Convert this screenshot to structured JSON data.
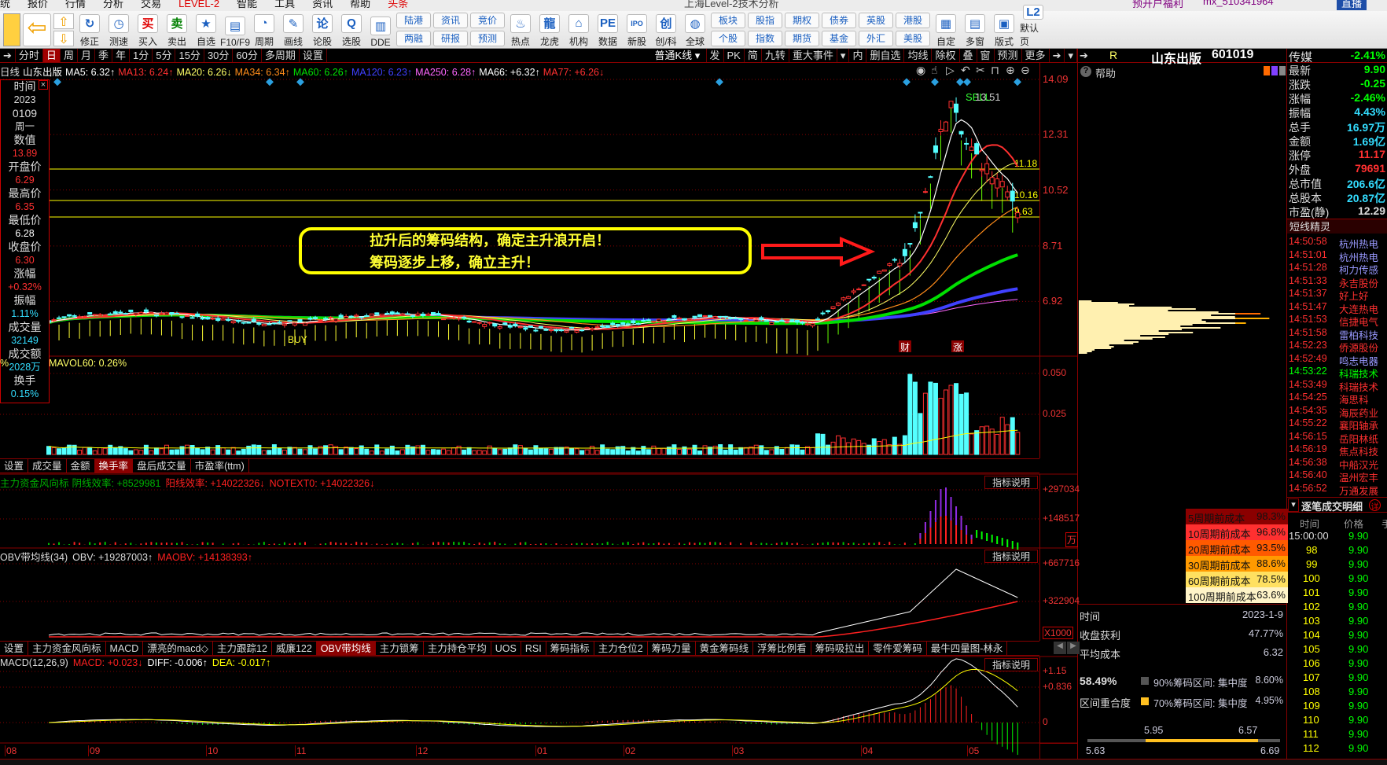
{
  "menubar": {
    "items": [
      "统",
      "报价",
      "行情",
      "分析",
      "交易",
      "LEVEL-2",
      "智能",
      "工具",
      "资讯",
      "帮助",
      "头条"
    ],
    "title": "上海Level-2技术分析",
    "promo": "预开户福利",
    "account": "mx_510341964",
    "live": "直播"
  },
  "toolbar": {
    "buttons": [
      {
        "label": "修正",
        "icon": "refresh-icon",
        "glyph": "↻"
      },
      {
        "label": "测速",
        "icon": "clock-icon",
        "glyph": "◷"
      },
      {
        "label": "买入",
        "icon": "buy-icon",
        "glyph": "买",
        "color": "#e00000"
      },
      {
        "label": "卖出",
        "icon": "sell-icon",
        "glyph": "卖",
        "color": "#008000"
      },
      {
        "label": "自选",
        "icon": "folder-star-icon",
        "glyph": "★"
      },
      {
        "label": "F10/F9",
        "icon": "document-icon",
        "glyph": "▤"
      },
      {
        "label": "周期",
        "icon": "period-clock-icon",
        "glyph": "◔"
      },
      {
        "label": "画线",
        "icon": "pencil-icon",
        "glyph": "✎"
      },
      {
        "label": "论股",
        "icon": "discuss-icon",
        "glyph": "论"
      },
      {
        "label": "选股",
        "icon": "magnifier-icon",
        "glyph": "Q"
      },
      {
        "label": "DDE",
        "icon": "dde-chart-icon",
        "glyph": "▥"
      }
    ],
    "pairs1": [
      [
        "陆港",
        "两融"
      ],
      [
        "资讯",
        "研报"
      ],
      [
        "竞价",
        "预测"
      ]
    ],
    "buttons2": [
      {
        "label": "热点",
        "icon": "hot-fire-icon",
        "glyph": "♨"
      },
      {
        "label": "龙虎",
        "icon": "dragon-icon",
        "glyph": "龍"
      },
      {
        "label": "机构",
        "icon": "institution-icon",
        "glyph": "⌂"
      },
      {
        "label": "数据",
        "icon": "pe-data-icon",
        "glyph": "PE"
      },
      {
        "label": "新股",
        "icon": "ipo-icon",
        "glyph": "IPO"
      },
      {
        "label": "创/科",
        "icon": "chuang-icon",
        "glyph": "创"
      },
      {
        "label": "全球",
        "icon": "globe-icon",
        "glyph": "◍"
      }
    ],
    "pairs2": [
      [
        "板块",
        "个股"
      ],
      [
        "股指",
        "指数"
      ],
      [
        "期权",
        "期货"
      ],
      [
        "债券",
        "基金"
      ],
      [
        "英股",
        "外汇"
      ],
      [
        "港股",
        "美股"
      ]
    ],
    "buttons3": [
      {
        "label": "自定",
        "icon": "custom-icon",
        "glyph": "▦"
      },
      {
        "label": "多窗",
        "icon": "multi-window-icon",
        "glyph": "▤"
      },
      {
        "label": "版式",
        "icon": "layout-icon",
        "glyph": "▣"
      },
      {
        "label": "默认页",
        "icon": "home-l2-icon",
        "glyph": "L2"
      }
    ]
  },
  "periods": {
    "items": [
      "分时",
      "日",
      "周",
      "月",
      "季",
      "年",
      "1分",
      "5分",
      "15分",
      "30分",
      "60分",
      "多周期",
      "设置"
    ],
    "selected": "日",
    "right": [
      "普通K线 ▾",
      "发",
      "PK",
      "简",
      "九转",
      "重大事件",
      "▾",
      "内",
      "删自选",
      "均线",
      "除权",
      "叠",
      "窗",
      "预测",
      "更多",
      "➔",
      "▾"
    ]
  },
  "ma_legend": {
    "prefix": "日线",
    "stock": "山东出版",
    "items": [
      {
        "text": "MA5: 6.32↑",
        "color": "#ffffff"
      },
      {
        "text": "MA13: 6.24↑",
        "color": "#ff3030"
      },
      {
        "text": "MA20: 6.26↓",
        "color": "#ffff66"
      },
      {
        "text": "MA34: 6.34↑",
        "color": "#ff8c1a"
      },
      {
        "text": "MA60: 6.26↑",
        "color": "#00e000"
      },
      {
        "text": "MA120: 6.23↑",
        "color": "#4040ff"
      },
      {
        "text": "MA250: 6.28↑",
        "color": "#ff66ff"
      },
      {
        "text": "MA66: +6.32↑",
        "color": "#ffffff"
      },
      {
        "text": "MA77: +6.26↓",
        "color": "#ff3030"
      }
    ]
  },
  "info_panel": [
    {
      "t": "时间",
      "c": "#ddd"
    },
    {
      "t": "2023",
      "c": "#ddd"
    },
    {
      "t": "0109",
      "c": "#ddd"
    },
    {
      "t": "周一",
      "c": "#ddd"
    },
    {
      "t": "数值",
      "c": "#ddd"
    },
    {
      "t": "13.89",
      "c": "#ff3030"
    },
    {
      "t": "开盘价",
      "c": "#ddd"
    },
    {
      "t": "6.29",
      "c": "#ff3030"
    },
    {
      "t": "最高价",
      "c": "#ddd"
    },
    {
      "t": "6.35",
      "c": "#ff3030"
    },
    {
      "t": "最低价",
      "c": "#ddd"
    },
    {
      "t": "6.28",
      "c": "#fff"
    },
    {
      "t": "收盘价",
      "c": "#ddd"
    },
    {
      "t": "6.30",
      "c": "#ff3030"
    },
    {
      "t": "涨幅",
      "c": "#ddd"
    },
    {
      "t": "+0.32%",
      "c": "#ff3030"
    },
    {
      "t": "振幅",
      "c": "#ddd"
    },
    {
      "t": "1.11%",
      "c": "#33ddff"
    },
    {
      "t": "成交量",
      "c": "#ddd"
    },
    {
      "t": "32149",
      "c": "#33ddff"
    },
    {
      "t": "成交额",
      "c": "#ddd"
    },
    {
      "t": "2028万",
      "c": "#33ddff"
    },
    {
      "t": "换手",
      "c": "#ddd"
    },
    {
      "t": "0.15%",
      "c": "#33ddff"
    }
  ],
  "main_chart": {
    "price_ticks": [
      "14.09",
      "12.31",
      "10.52",
      "8.71",
      "6.92"
    ],
    "high_label": "13.51",
    "sell_label": "SELL",
    "buy_label": "BUY",
    "levels": [
      "11.18",
      "10.16",
      "9.63"
    ],
    "event_labels": [
      "财",
      "涨"
    ],
    "annotation": [
      "拉升后的筹码结构，确定主升浪开启！",
      "筹码逐步上移，确立主升！"
    ]
  },
  "volume": {
    "header": "MAVOL60: 0.26%",
    "ticks": [
      "0.050",
      "0.025"
    ]
  },
  "tabs1": {
    "items": [
      "设置",
      "成交量",
      "金额",
      "换手率",
      "盘后成交量",
      "市盈率(ttm)"
    ],
    "selected": "换手率"
  },
  "ind1": {
    "name": "主力资金风向标",
    "items": [
      {
        "text": "阴线效率: +8529981",
        "color": "#00b000"
      },
      {
        "text": "阳线效率: +14022326↓",
        "color": "#ff2020"
      },
      {
        "text": "NOTEXT0: +14022326↓",
        "color": "#ff2020"
      }
    ],
    "ticks": [
      "+297034",
      "+148517"
    ],
    "unit": "万",
    "explain": "指标说明"
  },
  "obv": {
    "items": [
      {
        "text": "OBV带均线(34)",
        "color": "#ddd"
      },
      {
        "text": "OBV: +19287003↑",
        "color": "#ddd"
      },
      {
        "text": "MAOBV: +14138393↑",
        "color": "#ff2020"
      }
    ],
    "ticks": [
      "+667716",
      "+322904"
    ],
    "unit": "X1000",
    "explain": "指标说明"
  },
  "tabs2": {
    "items": [
      "设置",
      "主力资金风向标",
      "MACD",
      "漂亮的macd◇",
      "主力跟踪12",
      "威廉122",
      "OBV带均线",
      "主力锁筹",
      "主力持仓平均",
      "UOS",
      "RSI",
      "筹码指标",
      "主力仓位2",
      "筹码力量",
      "黄金筹码线",
      "浮筹比例看",
      "筹码吸拉出",
      "零件爱筹码",
      "最牛四量图-林永"
    ],
    "selected": "OBV带均线"
  },
  "macd": {
    "items": [
      {
        "text": "MACD(12,26,9)",
        "color": "#ddd"
      },
      {
        "text": "MACD: +0.023↓",
        "color": "#ff2020"
      },
      {
        "text": "DIFF: -0.006↑",
        "color": "#fff"
      },
      {
        "text": "DEA: -0.017↑",
        "color": "#ffff00"
      }
    ],
    "ticks": [
      "+1.15",
      "+0.836",
      "0"
    ],
    "explain": "指标说明"
  },
  "x_axis": [
    "08",
    "09",
    "10",
    "11",
    "12",
    "01",
    "02",
    "03",
    "04",
    "05"
  ],
  "chip_panel": {
    "flag": "R",
    "stock": "山东出版",
    "code": "601019",
    "help": "帮助",
    "cost_table": [
      {
        "label": "5周期前成本",
        "value": "98.3%",
        "bg": "#8b0000"
      },
      {
        "label": "10周期前成本",
        "value": "96.8%",
        "bg": "#ff3030"
      },
      {
        "label": "20周期前成本",
        "value": "93.5%",
        "bg": "#ff5a00"
      },
      {
        "label": "30周期前成本",
        "value": "88.6%",
        "bg": "#ff9a00"
      },
      {
        "label": "60周期前成本",
        "value": "78.5%",
        "bg": "#ffe060"
      },
      {
        "label": "100周期前成本",
        "value": "63.6%",
        "bg": "#fff4c8"
      }
    ],
    "stats": [
      {
        "k": "时间",
        "v": "2023-1-9"
      },
      {
        "k": "收盘获利",
        "v": "47.77%"
      },
      {
        "k": "平均成本",
        "v": "6.32"
      }
    ],
    "overlap_value": "58.49%",
    "overlap_label": "区间重合度",
    "ranges": [
      {
        "text": "90%筹码区间: 集中度",
        "value": "8.60%",
        "color": "#555555"
      },
      {
        "text": "70%筹码区间: 集中度",
        "value": "4.95%",
        "color": "#ffc020"
      }
    ],
    "bar": {
      "inner_low": "5.95",
      "inner_high": "6.57",
      "outer_low": "5.63",
      "outer_high": "6.69"
    }
  },
  "quote": {
    "sector": "传媒",
    "sector_change": "-2.41%",
    "rows": [
      {
        "k": "最新",
        "v": "9.90",
        "c": "#00ff00"
      },
      {
        "k": "涨跌",
        "v": "-0.25",
        "c": "#00ff00"
      },
      {
        "k": "涨幅",
        "v": "-2.46%",
        "c": "#00ff00"
      },
      {
        "k": "振幅",
        "v": "4.43%",
        "c": "#33ddff"
      },
      {
        "k": "总手",
        "v": "16.97万",
        "c": "#33ddff"
      },
      {
        "k": "金额",
        "v": "1.69亿",
        "c": "#33ddff"
      },
      {
        "k": "涨停",
        "v": "11.17",
        "c": "#ff3030"
      },
      {
        "k": "外盘",
        "v": "79691",
        "c": "#ff3030"
      },
      {
        "k": "总市值",
        "v": "206.6亿",
        "c": "#33ddff"
      },
      {
        "k": "总股本",
        "v": "20.87亿",
        "c": "#33ddff"
      },
      {
        "k": "市盈(静)",
        "v": "12.29",
        "c": "#ddd"
      }
    ],
    "sprite_title": "短线精灵",
    "sprite": [
      {
        "t": "14:50:58",
        "n": "杭州热电",
        "c": "#9999ff"
      },
      {
        "t": "14:51:01",
        "n": "杭州热电",
        "c": "#9999ff"
      },
      {
        "t": "14:51:28",
        "n": "柯力传感",
        "c": "#9999ff"
      },
      {
        "t": "14:51:33",
        "n": "永吉股份",
        "c": "#ff3030"
      },
      {
        "t": "14:51:37",
        "n": "好上好",
        "c": "#ff3030"
      },
      {
        "t": "14:51:47",
        "n": "大连热电",
        "c": "#ff3030"
      },
      {
        "t": "14:51:53",
        "n": "信捷电气",
        "c": "#ff3030"
      },
      {
        "t": "14:51:58",
        "n": "雷柏科技",
        "c": "#9999ff"
      },
      {
        "t": "14:52:23",
        "n": "侨源股份",
        "c": "#ff3030"
      },
      {
        "t": "14:52:49",
        "n": "鸣志电器",
        "c": "#9999ff"
      },
      {
        "t": "14:53:22",
        "n": "科瑞技术",
        "c": "#00ff00",
        "tc": "#00ff00"
      },
      {
        "t": "14:53:49",
        "n": "科瑞技术",
        "c": "#ff3030"
      },
      {
        "t": "14:54:25",
        "n": "海思科",
        "c": "#ff3030"
      },
      {
        "t": "14:54:35",
        "n": "海辰药业",
        "c": "#ff3030"
      },
      {
        "t": "14:55:22",
        "n": "襄阳轴承",
        "c": "#ff3030"
      },
      {
        "t": "14:56:15",
        "n": "岳阳林纸",
        "c": "#ff3030"
      },
      {
        "t": "14:56:19",
        "n": "焦点科技",
        "c": "#ff3030"
      },
      {
        "t": "14:56:38",
        "n": "中船汉光",
        "c": "#ff3030"
      },
      {
        "t": "14:56:40",
        "n": "温州宏丰",
        "c": "#ff3030"
      },
      {
        "t": "14:56:52",
        "n": "万通发展",
        "c": "#ff3030"
      }
    ],
    "trades_title": "逐笔成交明细",
    "trades_badge": "详",
    "trade_cols": [
      "时间",
      "价格",
      "手"
    ],
    "trades": [
      {
        "t": "15:00:00",
        "p": "9.90"
      },
      {
        "t": "98",
        "p": "9.90"
      },
      {
        "t": "99",
        "p": "9.90"
      },
      {
        "t": "100",
        "p": "9.90"
      },
      {
        "t": "101",
        "p": "9.90"
      },
      {
        "t": "102",
        "p": "9.90"
      },
      {
        "t": "103",
        "p": "9.90"
      },
      {
        "t": "104",
        "p": "9.90"
      },
      {
        "t": "105",
        "p": "9.90"
      },
      {
        "t": "106",
        "p": "9.90"
      },
      {
        "t": "107",
        "p": "9.90"
      },
      {
        "t": "108",
        "p": "9.90"
      },
      {
        "t": "109",
        "p": "9.90"
      },
      {
        "t": "110",
        "p": "9.90"
      },
      {
        "t": "111",
        "p": "9.90"
      },
      {
        "t": "112",
        "p": "9.90"
      }
    ]
  },
  "colors": {
    "up": "#ff3030",
    "down": "#54ffff",
    "grid": "#800000",
    "accent": "#a00000"
  }
}
